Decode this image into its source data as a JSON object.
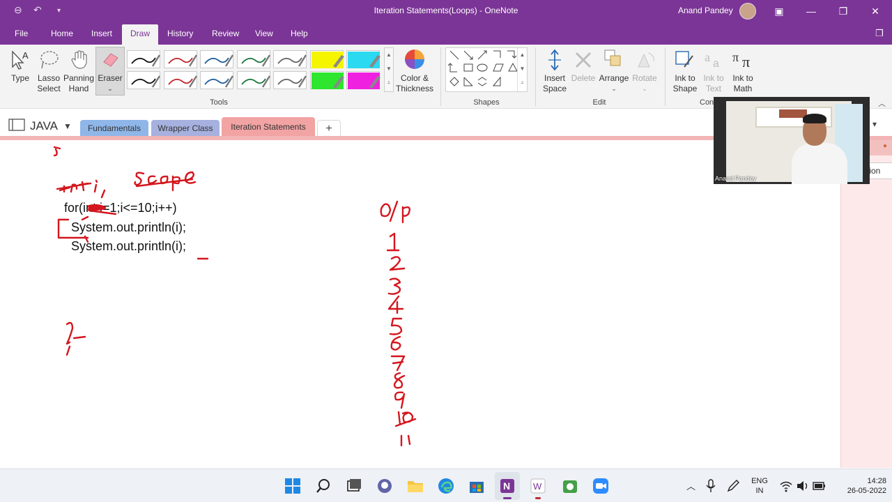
{
  "titlebar": {
    "title": "Iteration Statements(Loops)  -  OneNote",
    "user_name": "Anand Pandey"
  },
  "menu": {
    "tabs": [
      "File",
      "Home",
      "Insert",
      "Draw",
      "History",
      "Review",
      "View",
      "Help"
    ],
    "active": "Draw"
  },
  "ribbon": {
    "tools": {
      "type": "Type",
      "lasso": [
        "Lasso",
        "Select"
      ],
      "panning": [
        "Panning",
        "Hand"
      ],
      "eraser": "Eraser",
      "color_thickness": [
        "Color &",
        "Thickness"
      ],
      "group_label": "Tools"
    },
    "shapes": {
      "group_label": "Shapes"
    },
    "edit": {
      "insert_space": [
        "Insert",
        "Space"
      ],
      "delete": "Delete",
      "arrange": "Arrange",
      "rotate": "Rotate",
      "group_label": "Edit"
    },
    "convert": {
      "ink_to_shape": [
        "Ink to",
        "Shape"
      ],
      "ink_to_text": [
        "Ink to",
        "Text"
      ],
      "ink_to_math": [
        "Ink to",
        "Math"
      ],
      "group_label": "Con"
    },
    "pen_colors": [
      "#111111",
      "#c0292e",
      "#1f5fa0",
      "#1b7a3d",
      "#666666",
      "#f5f500",
      "#2bd9f0",
      "#111111",
      "#c0292e",
      "#1f5fa0",
      "#1b7a3d",
      "#666666",
      "#2ee62e",
      "#f020e0"
    ]
  },
  "notebook": {
    "name": "JAVA",
    "sections": [
      {
        "label": "Fundamentals",
        "color": "#8fb6e8"
      },
      {
        "label": "Wrapper Class",
        "color": "#a7b1df"
      },
      {
        "label": "Iteration Statements",
        "color": "#f2a3a3"
      }
    ],
    "add_section": "+"
  },
  "page": {
    "code_lines": [
      "for(int i=1;i<=10;i++)",
      "System.out.println(i);",
      "System.out.println(i);"
    ],
    "ink_notes": {
      "op_label": "O/P",
      "outputs": [
        "1",
        "2",
        "3",
        "4",
        "5",
        "6",
        "7",
        "8",
        "9",
        "10",
        "11"
      ],
      "scope": "scope",
      "int_i": "int i;"
    }
  },
  "webcam": {
    "caption": "Anand Pandey"
  },
  "right_panel": {
    "label": "tion"
  },
  "taskbar": {
    "language": [
      "ENG",
      "IN"
    ],
    "time": "14:28",
    "date": "26-05-2022"
  }
}
